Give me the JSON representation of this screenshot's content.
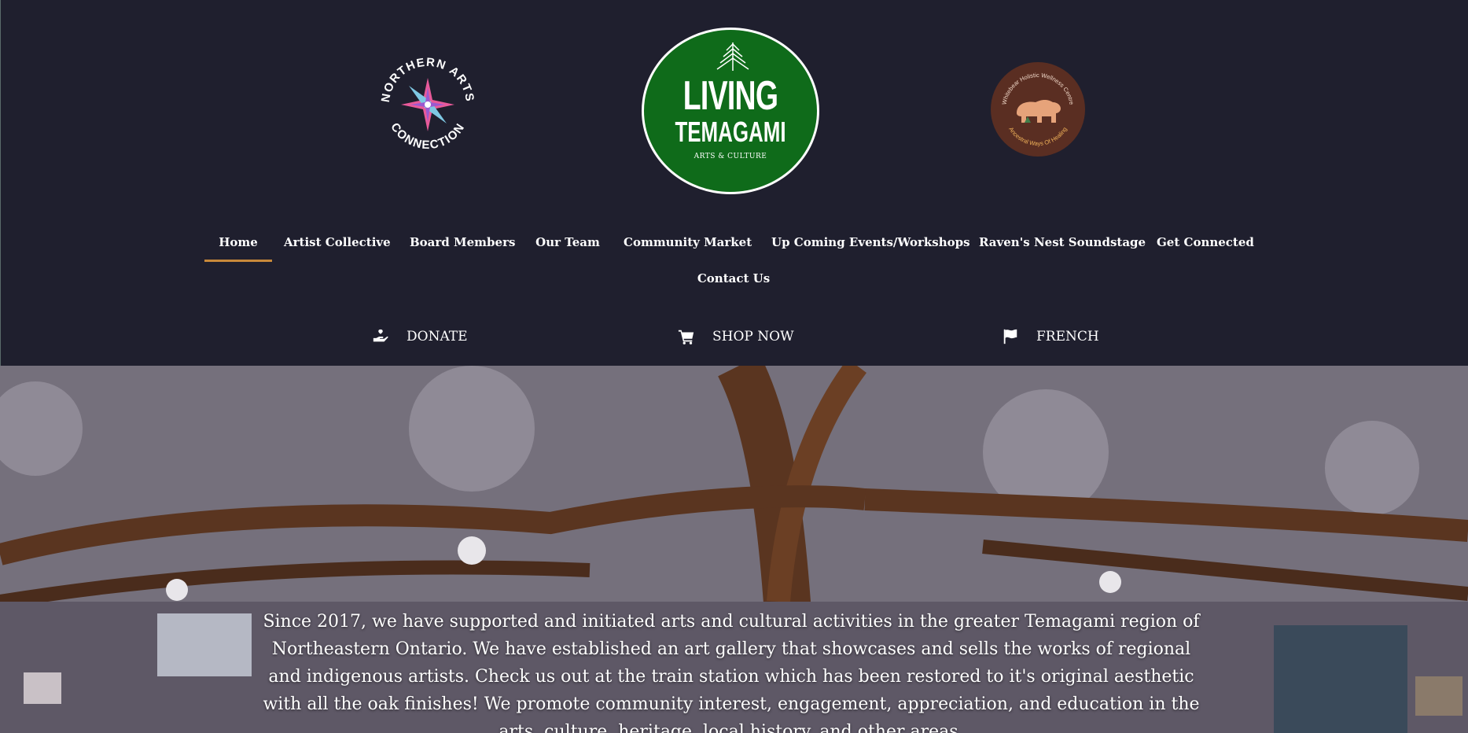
{
  "logos": {
    "left": {
      "text_top": "NORTHERN ARTS",
      "text_bottom": "CONNECTION"
    },
    "center": {
      "line1": "LIVING",
      "line2": "TEMAGAMI",
      "line3": "ARTS & CULTURE"
    },
    "right": {
      "text_top": "Whitebear Holistic Wellness Centre",
      "text_bottom": "Ancestral Ways Of Healing"
    }
  },
  "nav": {
    "items": [
      {
        "label": "Home",
        "active": true
      },
      {
        "label": "Artist Collective"
      },
      {
        "label": "Board Members"
      },
      {
        "label": "Our Team"
      },
      {
        "label": "Community Market"
      },
      {
        "label": "Up Coming Events/Workshops"
      },
      {
        "label": "Raven's Nest Soundstage"
      },
      {
        "label": "Get Connected"
      },
      {
        "label": "Contact Us"
      }
    ]
  },
  "actions": {
    "donate": {
      "label": "DONATE",
      "icon": "donate-hand-icon"
    },
    "shop": {
      "label": "SHOP NOW",
      "icon": "shopping-cart-icon"
    },
    "french": {
      "label": "FRENCH",
      "icon": "flag-icon"
    }
  },
  "hero": {
    "text": "Since 2017, we have supported and initiated arts and cultural activities in the greater Temagami region of Northeastern Ontario. We have established an art gallery that showcases and sells the works of regional and indigenous artists. Check us out at the train station which has been restored to it's original aesthetic with all the oak finishes! We promote community interest, engagement, appreciation, and education in the arts, culture, heritage, local history, and other areas."
  },
  "colors": {
    "background": "#1f1f2e",
    "accent": "#c8893a",
    "logo_green": "#0f6b1a",
    "logo_brown": "#5a2e22"
  }
}
